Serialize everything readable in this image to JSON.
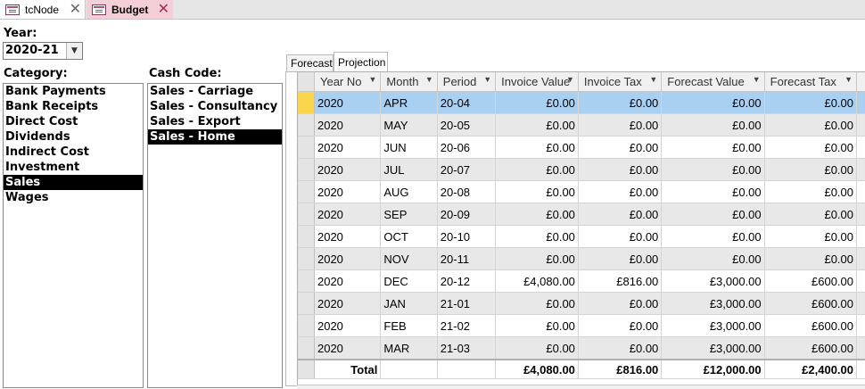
{
  "doc_tabs": [
    {
      "label": "tcNode",
      "close": "✕"
    },
    {
      "label": "Budget",
      "close": "✕"
    }
  ],
  "year": {
    "label": "Year:",
    "value": "2020-21"
  },
  "category": {
    "label": "Category:",
    "items": [
      "Bank Payments",
      "Bank Receipts",
      "Direct Cost",
      "Dividends",
      "Indirect Cost",
      "Investment",
      "Sales",
      "Wages"
    ],
    "selected": "Sales"
  },
  "cash_code": {
    "label": "Cash Code:",
    "items": [
      "Sales - Carriage",
      "Sales - Consultancy",
      "Sales - Export",
      "Sales - Home"
    ],
    "selected": "Sales - Home"
  },
  "sub_tabs": [
    "Forecast",
    "Projection"
  ],
  "active_sub_tab": "Projection",
  "grid": {
    "columns": [
      "Year No",
      "Month",
      "Period",
      "Invoice Value",
      "Invoice Tax",
      "Forecast Value",
      "Forecast Tax"
    ],
    "rows": [
      [
        "2020",
        "APR",
        "20-04",
        "£0.00",
        "£0.00",
        "£0.00",
        "£0.00"
      ],
      [
        "2020",
        "MAY",
        "20-05",
        "£0.00",
        "£0.00",
        "£0.00",
        "£0.00"
      ],
      [
        "2020",
        "JUN",
        "20-06",
        "£0.00",
        "£0.00",
        "£0.00",
        "£0.00"
      ],
      [
        "2020",
        "JUL",
        "20-07",
        "£0.00",
        "£0.00",
        "£0.00",
        "£0.00"
      ],
      [
        "2020",
        "AUG",
        "20-08",
        "£0.00",
        "£0.00",
        "£0.00",
        "£0.00"
      ],
      [
        "2020",
        "SEP",
        "20-09",
        "£0.00",
        "£0.00",
        "£0.00",
        "£0.00"
      ],
      [
        "2020",
        "OCT",
        "20-10",
        "£0.00",
        "£0.00",
        "£0.00",
        "£0.00"
      ],
      [
        "2020",
        "NOV",
        "20-11",
        "£0.00",
        "£0.00",
        "£0.00",
        "£0.00"
      ],
      [
        "2020",
        "DEC",
        "20-12",
        "£4,080.00",
        "£816.00",
        "£3,000.00",
        "£600.00"
      ],
      [
        "2020",
        "JAN",
        "21-01",
        "£0.00",
        "£0.00",
        "£3,000.00",
        "£600.00"
      ],
      [
        "2020",
        "FEB",
        "21-02",
        "£0.00",
        "£0.00",
        "£3,000.00",
        "£600.00"
      ],
      [
        "2020",
        "MAR",
        "21-03",
        "£0.00",
        "£0.00",
        "£3,000.00",
        "£600.00"
      ]
    ],
    "total": {
      "label": "Total",
      "invoice_value": "£4,080.00",
      "invoice_tax": "£816.00",
      "forecast_value": "£12,000.00",
      "forecast_tax": "£2,400.00"
    }
  }
}
